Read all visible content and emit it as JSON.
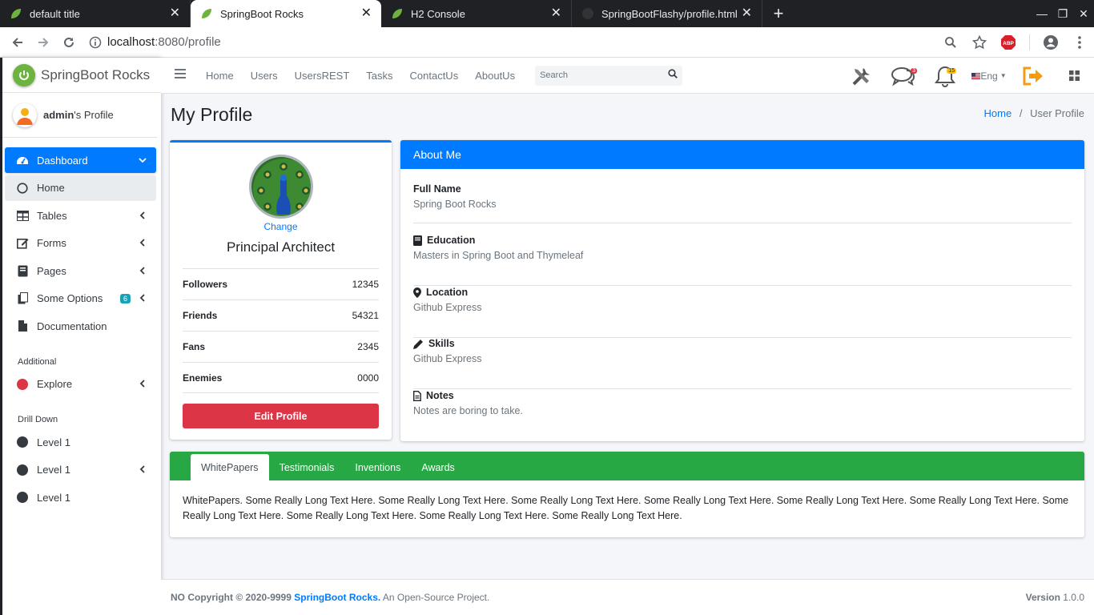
{
  "browser": {
    "tabs": [
      {
        "title": "default title",
        "icon": "spring-leaf-icon",
        "active": false
      },
      {
        "title": "SpringBoot Rocks",
        "icon": "spring-leaf-icon",
        "active": true
      },
      {
        "title": "H2 Console",
        "icon": "spring-leaf-icon",
        "active": false
      },
      {
        "title": "SpringBootFlashy/profile.html a",
        "icon": "github-icon",
        "active": false
      }
    ],
    "url_host": "localhost",
    "url_path": ":8080/profile",
    "adblock_label": "ABP"
  },
  "sidebar": {
    "brand": "SpringBoot Rocks",
    "user_name": "admin",
    "user_suffix": "'s Profile",
    "items": [
      {
        "label": "Dashboard",
        "icon": "dashboard-icon",
        "state": "active",
        "chevron": "down"
      },
      {
        "label": "Home",
        "icon": "circle-outline-icon",
        "state": "selected"
      },
      {
        "label": "Tables",
        "icon": "table-icon",
        "chevron": "left"
      },
      {
        "label": "Forms",
        "icon": "edit-icon",
        "chevron": "left"
      },
      {
        "label": "Pages",
        "icon": "book-icon",
        "chevron": "left"
      },
      {
        "label": "Some Options",
        "icon": "copy-icon",
        "chevron": "left",
        "badge": "6"
      },
      {
        "label": "Documentation",
        "icon": "file-icon"
      }
    ],
    "additional_header": "Additional",
    "explore_label": "Explore",
    "drilldown_header": "Drill Down",
    "levels": [
      "Level 1",
      "Level 1",
      "Level 1"
    ],
    "colors": {
      "active": "#007bff",
      "explore": "#dc3545",
      "level": "#343a40"
    }
  },
  "topnav": {
    "links": [
      "Home",
      "Users",
      "UsersREST",
      "Tasks",
      "ContactUs",
      "AboutUs"
    ],
    "search_placeholder": "Search",
    "messages_badge": "3",
    "notifications_badge": "15",
    "language": "Eng"
  },
  "page": {
    "title": "My Profile",
    "breadcrumb_home": "Home",
    "breadcrumb_sep": "/",
    "breadcrumb_current": "User Profile"
  },
  "profile": {
    "change_label": "Change",
    "role": "Principal Architect",
    "stats": [
      {
        "label": "Followers",
        "value": "12345"
      },
      {
        "label": "Friends",
        "value": "54321"
      },
      {
        "label": "Fans",
        "value": "2345"
      },
      {
        "label": "Enemies",
        "value": "0000"
      }
    ],
    "edit_button": "Edit Profile"
  },
  "about": {
    "header": "About Me",
    "rows": [
      {
        "label": "Full Name",
        "value": "Spring Boot Rocks",
        "icon": ""
      },
      {
        "label": "Education",
        "value": "Masters in Spring Boot and Thymeleaf",
        "icon": "book-icon"
      },
      {
        "label": "Location",
        "value": "Github Express",
        "icon": "map-marker-icon"
      },
      {
        "label": "Skills",
        "value": "Github Express",
        "icon": "pencil-icon"
      },
      {
        "label": "Notes",
        "value": "Notes are boring to take.",
        "icon": "file-text-icon"
      }
    ]
  },
  "tabs": {
    "items": [
      "WhitePapers",
      "Testimonials",
      "Inventions",
      "Awards"
    ],
    "active_index": 0,
    "body": "WhitePapers. Some Really Long Text Here. Some Really Long Text Here. Some Really Long Text Here. Some Really Long Text Here. Some Really Long Text Here. Some Really Long Text Here. Some Really Long Text Here. Some Really Long Text Here. Some Really Long Text Here. Some Really Long Text Here."
  },
  "footer": {
    "copyright": "NO Copyright © 2020-9999 ",
    "brand": "SpringBoot Rocks.",
    "suffix": " An Open-Source Project.",
    "version_label": "Version",
    "version": " 1.0.0"
  }
}
